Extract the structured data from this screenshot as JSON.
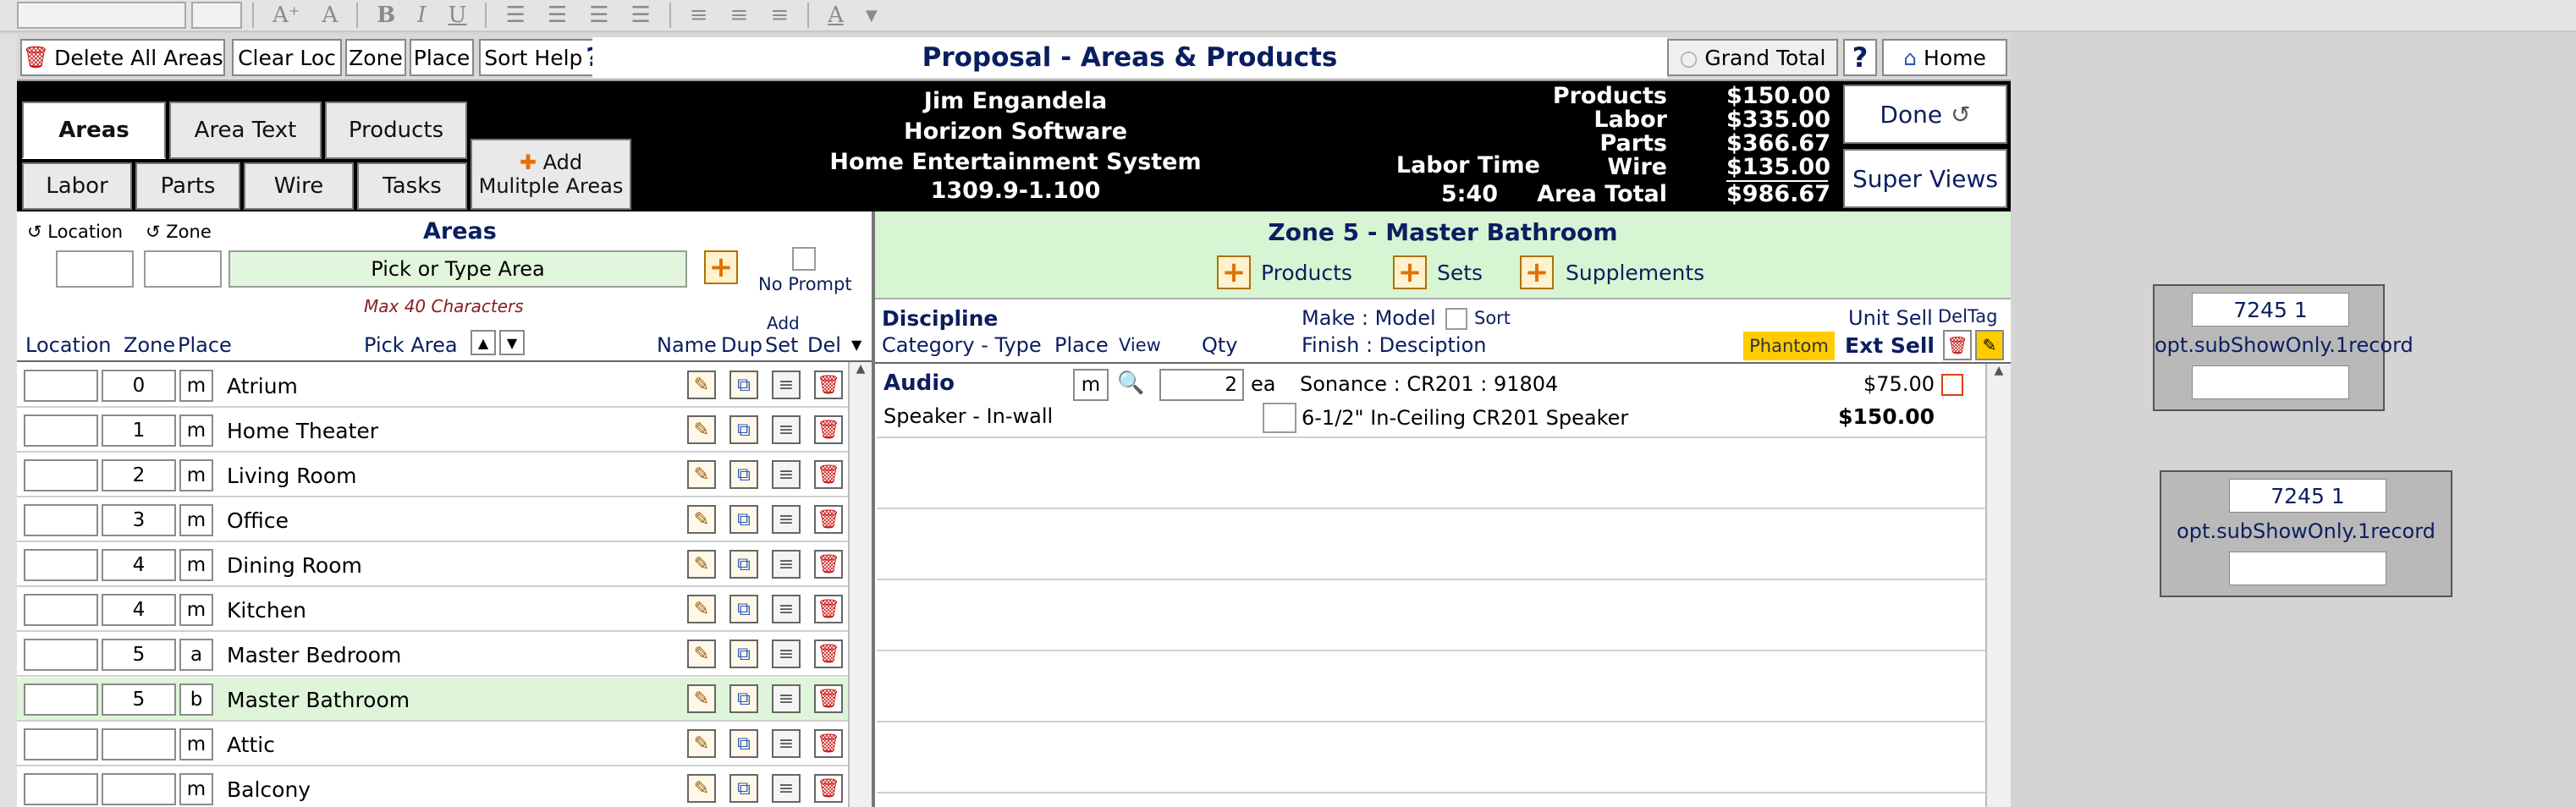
{
  "toolbar": {
    "font_size_up": "A⁺",
    "font_size_down": "A",
    "bold": "B",
    "italic": "I",
    "underline": "U",
    "font_color": "A"
  },
  "topbar": {
    "delete_all_areas": "Delete All Areas",
    "clear_loc": "Clear Loc",
    "zone": "Zone",
    "place": "Place",
    "sort_help": "Sort Help",
    "help_mark": "?",
    "title": "Proposal - Areas & Products",
    "grand_total": "Grand Total",
    "help": "?",
    "home": "Home"
  },
  "tabs": {
    "areas": "Areas",
    "area_text": "Area Text",
    "products": "Products",
    "labor": "Labor",
    "parts": "Parts",
    "wire": "Wire",
    "tasks": "Tasks",
    "add_multiple_line1": "Add",
    "add_multiple_line2": "Mulitple Areas"
  },
  "client": {
    "name": "Jim Engandela",
    "company": "Horizon Software",
    "project": "Home Entertainment System",
    "version": "1309.9-1.100"
  },
  "totals": {
    "labor_time_label": "Labor Time",
    "labor_time_value": "5:40",
    "products_label": "Products",
    "products_value": "$150.00",
    "labor_label": "Labor",
    "labor_value": "$335.00",
    "parts_label": "Parts",
    "parts_value": "$366.67",
    "wire_label": "Wire",
    "wire_value": "$135.00",
    "area_total_label": "Area Total",
    "area_total_value": "$986.67"
  },
  "side_buttons": {
    "done": "Done",
    "super_views": "Super Views"
  },
  "areas_header": {
    "location_sort": "Location",
    "zone_sort": "Zone",
    "title": "Areas",
    "pick_placeholder": "Pick or Type Area",
    "no_prompt": "No Prompt",
    "max_chars": "Max 40 Characters",
    "col_location": "Location",
    "col_zone": "Zone",
    "col_place": "Place",
    "col_pick_area": "Pick Area",
    "col_name": "Name",
    "col_dup": "Dup",
    "col_add_set_top": "Add",
    "col_add_set": "Set",
    "col_del": "Del"
  },
  "areas": [
    {
      "location": "",
      "zone": "0",
      "place": "m",
      "name": "Atrium",
      "selected": false
    },
    {
      "location": "",
      "zone": "1",
      "place": "m",
      "name": "Home Theater",
      "selected": false
    },
    {
      "location": "",
      "zone": "2",
      "place": "m",
      "name": "Living Room",
      "selected": false
    },
    {
      "location": "",
      "zone": "3",
      "place": "m",
      "name": "Office",
      "selected": false
    },
    {
      "location": "",
      "zone": "4",
      "place": "m",
      "name": "Dining Room",
      "selected": false
    },
    {
      "location": "",
      "zone": "4",
      "place": "m",
      "name": "Kitchen",
      "selected": false
    },
    {
      "location": "",
      "zone": "5",
      "place": "a",
      "name": "Master Bedroom",
      "selected": false
    },
    {
      "location": "",
      "zone": "5",
      "place": "b",
      "name": "Master Bathroom",
      "selected": true
    },
    {
      "location": "",
      "zone": "",
      "place": "m",
      "name": "Attic",
      "selected": false
    },
    {
      "location": "",
      "zone": "",
      "place": "m",
      "name": "Balcony",
      "selected": false
    }
  ],
  "zone_panel": {
    "title": "Zone 5 - Master Bathroom",
    "add_products": "Products",
    "add_sets": "Sets",
    "add_supplements": "Supplements",
    "col_discipline": "Discipline",
    "col_category_type": "Category - Type",
    "col_place": "Place",
    "col_view": "View",
    "col_qty": "Qty",
    "col_make_model": "Make : Model",
    "col_sort": "Sort",
    "col_finish_desc": "Finish : Desciption",
    "phantom": "Phantom",
    "col_unit_sell": "Unit Sell",
    "col_ext_sell": "Ext Sell",
    "col_del_tag": "DelTag"
  },
  "products": [
    {
      "discipline": "Audio",
      "category_type": "Speaker - In-wall",
      "place": "m",
      "qty": "2",
      "unit": "ea",
      "make_model": "Sonance : CR201  : 91804",
      "description": "6-1/2\" In-Ceiling CR201 Speaker",
      "unit_sell": "$75.00",
      "ext_sell": "$150.00"
    }
  ],
  "cards": [
    {
      "id_text": "7245 1",
      "label": "opt.subShowOnly.1record"
    },
    {
      "id_text": "7245 1",
      "label": "opt.subShowOnly.1record"
    }
  ],
  "colors": {
    "navy_text": "#0a1e60",
    "selected_row": "#dff5d9",
    "zone_header": "#d7f5d3",
    "phantom_badge": "#ffcc00",
    "delete_red": "#cc1111"
  }
}
